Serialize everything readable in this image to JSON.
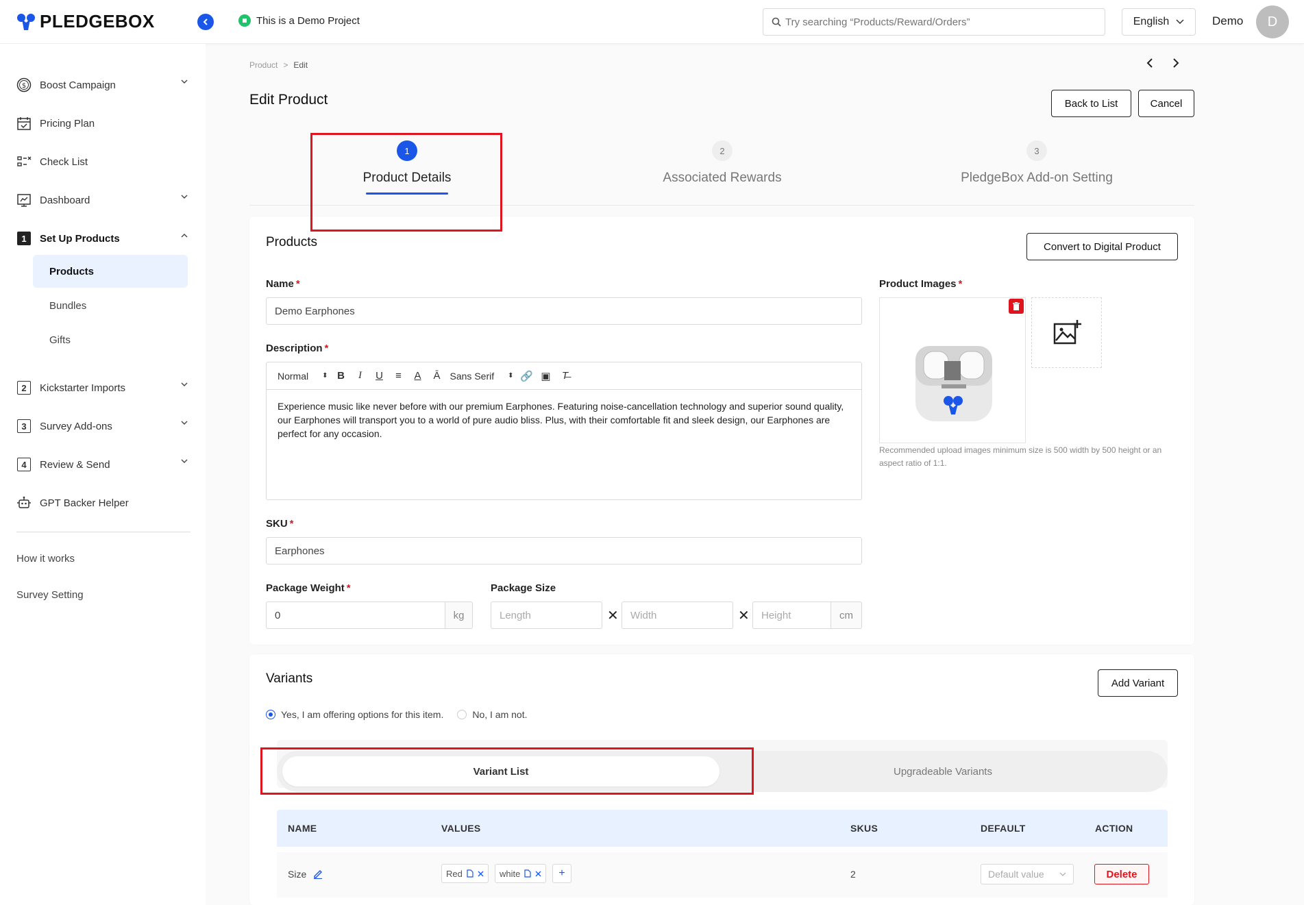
{
  "app": {
    "logo_text": "PLEDGEBOX",
    "brand_color": "#1a56e8",
    "alert_color": "#e0141e"
  },
  "topbar": {
    "demo_project": "This is a Demo Project",
    "search_placeholder": "Try searching “Products/Reward/Orders”",
    "language": "English",
    "user_name": "Demo",
    "avatar_initial": "D"
  },
  "sidebar": {
    "items": [
      {
        "label": "Boost Campaign",
        "icon": "dollar-circle-icon",
        "expandable": true
      },
      {
        "label": "Pricing Plan",
        "icon": "calendar-check-icon",
        "expandable": false
      },
      {
        "label": "Check List",
        "icon": "checklist-icon",
        "expandable": false
      },
      {
        "label": "Dashboard",
        "icon": "dashboard-icon",
        "expandable": true
      },
      {
        "label": "Set Up Products",
        "icon": "step-1-icon",
        "expandable": true,
        "expanded": true
      },
      {
        "label": "Kickstarter Imports",
        "icon": "step-2-icon",
        "expandable": true
      },
      {
        "label": "Survey Add-ons",
        "icon": "step-3-icon",
        "expandable": true
      },
      {
        "label": "Review & Send",
        "icon": "step-4-icon",
        "expandable": true
      },
      {
        "label": "GPT Backer Helper",
        "icon": "robot-icon",
        "expandable": false
      }
    ],
    "step_numbers": [
      "1",
      "2",
      "3",
      "4"
    ],
    "sub_items": [
      {
        "label": "Products",
        "active": true
      },
      {
        "label": "Bundles",
        "active": false
      },
      {
        "label": "Gifts",
        "active": false
      }
    ],
    "bottom_links": [
      "How it works",
      "Survey Setting"
    ]
  },
  "breadcrumb": {
    "parent": "Product",
    "separator": ">",
    "current": "Edit"
  },
  "page": {
    "title": "Edit Product",
    "back_button": "Back to List",
    "cancel_button": "Cancel"
  },
  "steps": [
    {
      "number": "1",
      "label": "Product Details",
      "active": true
    },
    {
      "number": "2",
      "label": "Associated Rewards",
      "active": false
    },
    {
      "number": "3",
      "label": "PledgeBox Add-on Setting",
      "active": false
    }
  ],
  "products_card": {
    "title": "Products",
    "convert_button": "Convert to Digital Product",
    "name_label": "Name",
    "name_value": "Demo Earphones",
    "description_label": "Description",
    "editor_toolbar": {
      "format": "Normal",
      "font": "Sans Serif"
    },
    "description_value": "Experience music like never before with our premium Earphones. Featuring noise-cancellation technology and superior sound quality, our Earphones will transport you to a world of pure audio bliss. Plus, with their comfortable fit and sleek design, our Earphones are perfect for any occasion.",
    "sku_label": "SKU",
    "sku_value": "Earphones",
    "weight_label": "Package Weight",
    "weight_value": "0",
    "weight_unit": "kg",
    "size_label": "Package Size",
    "length_placeholder": "Length",
    "width_placeholder": "Width",
    "height_placeholder": "Height",
    "size_unit": "cm",
    "times_symbol": "✕",
    "images_label": "Product Images",
    "image_note": "Recommended upload images minimum size is 500 width by 500 height or an aspect ratio of 1:1.",
    "required_mark": "*"
  },
  "variants_card": {
    "title": "Variants",
    "add_button": "Add Variant",
    "option_yes": "Yes, I am offering options for this item.",
    "option_no": "No, I am not.",
    "selected_option": "yes",
    "tabs": [
      {
        "label": "Variant List",
        "active": true
      },
      {
        "label": "Upgradeable Variants",
        "active": false
      }
    ],
    "columns": [
      "NAME",
      "VALUES",
      "SKUS",
      "DEFAULT",
      "ACTION"
    ],
    "rows": [
      {
        "name": "Size",
        "values": [
          "Red",
          "white"
        ],
        "skus": "2",
        "default_placeholder": "Default value",
        "action": "Delete"
      }
    ]
  }
}
